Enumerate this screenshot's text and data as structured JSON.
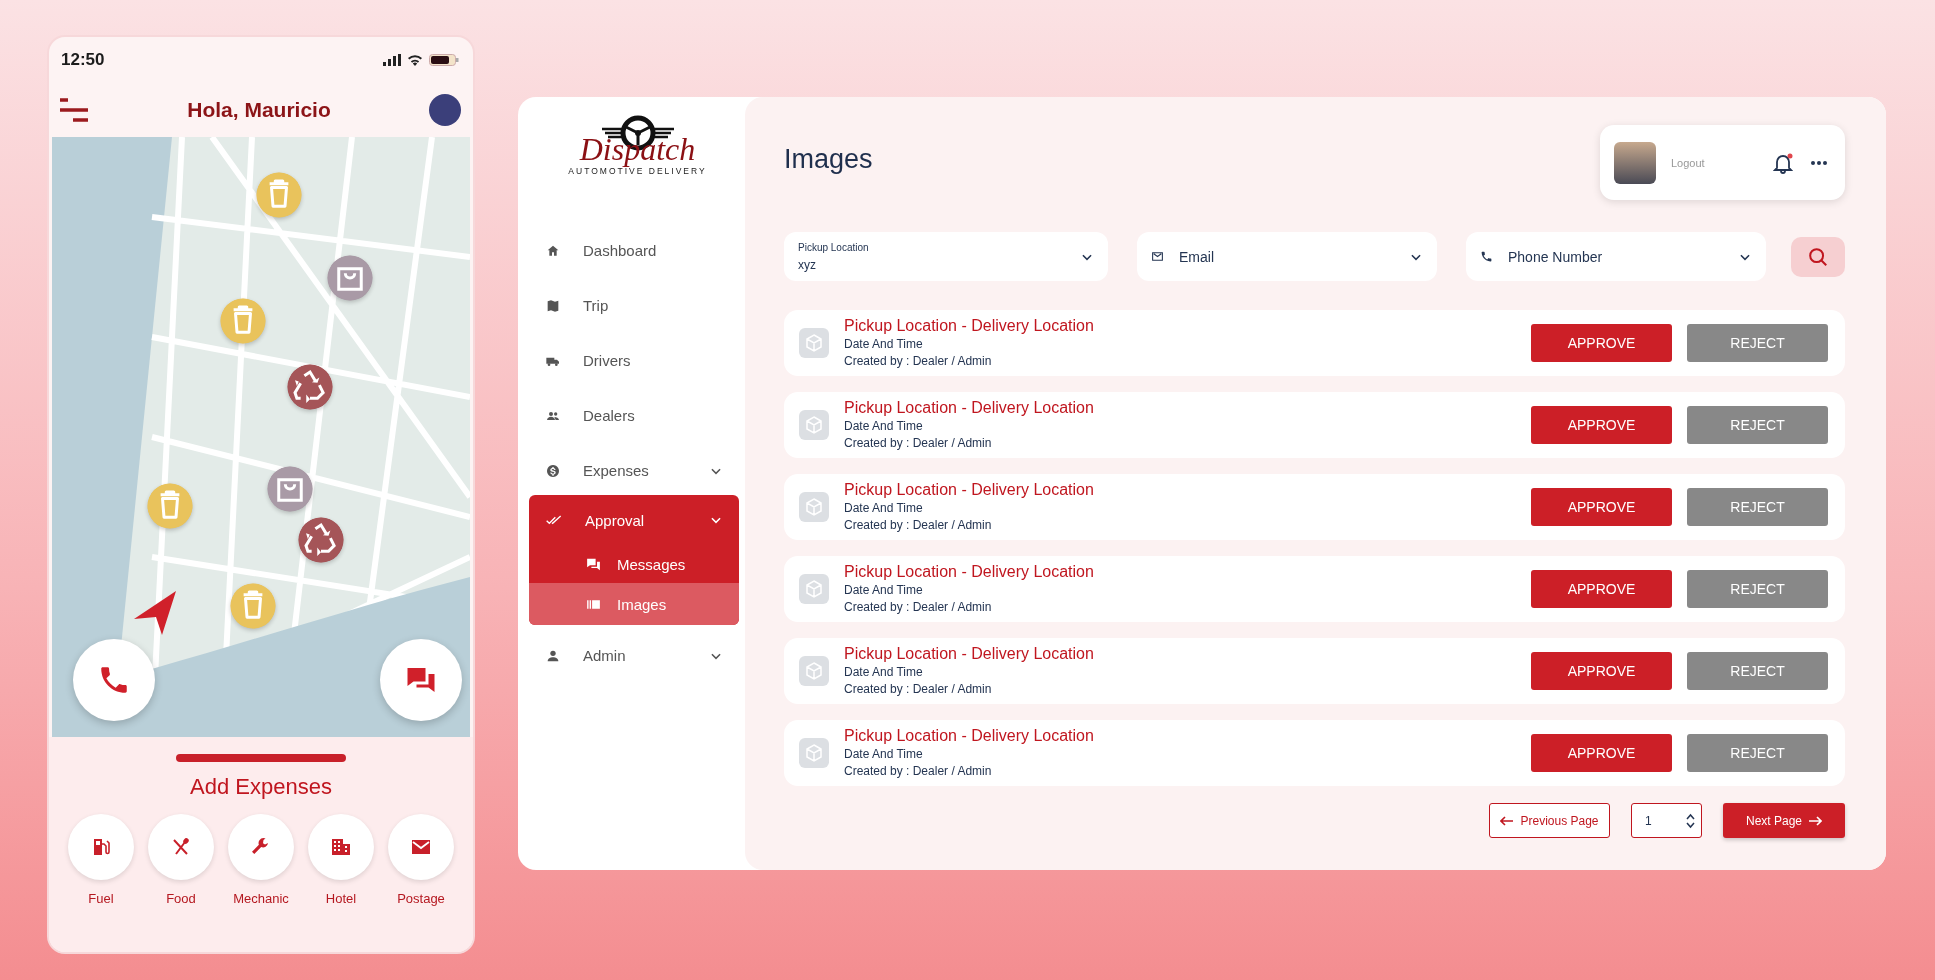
{
  "phone": {
    "time": "12:50",
    "greeting": "Hola, Mauricio",
    "map_pins": [
      {
        "kind": "trash",
        "color": "#e9c35c"
      },
      {
        "kind": "bag",
        "color": "#a99aa6"
      },
      {
        "kind": "trash",
        "color": "#e9c35c"
      },
      {
        "kind": "recycle",
        "color": "#a55558"
      },
      {
        "kind": "bag",
        "color": "#a99aa6"
      },
      {
        "kind": "trash",
        "color": "#e9c35c"
      },
      {
        "kind": "recycle",
        "color": "#a55558"
      },
      {
        "kind": "trash",
        "color": "#e9c35c"
      }
    ],
    "sheet_title": "Add Expenses",
    "expense_categories": [
      {
        "label": "Fuel",
        "kind": "fuel"
      },
      {
        "label": "Food",
        "kind": "food"
      },
      {
        "label": "Mechanic",
        "kind": "mechanic"
      },
      {
        "label": "Hotel",
        "kind": "hotel"
      },
      {
        "label": "Postage",
        "kind": "postage"
      }
    ]
  },
  "sidebar": {
    "logo": {
      "wordmark": "Dispatch",
      "tagline": "AUTOMOTIVE DELIVERY"
    },
    "items": [
      {
        "label": "Dashboard",
        "kind": "home",
        "expandable": false,
        "expanded": false,
        "selected": false
      },
      {
        "label": "Trip",
        "kind": "map",
        "expandable": false,
        "expanded": false,
        "selected": false
      },
      {
        "label": "Drivers",
        "kind": "truck",
        "expandable": false,
        "expanded": false,
        "selected": false
      },
      {
        "label": "Dealers",
        "kind": "people",
        "expandable": false,
        "expanded": false,
        "selected": false
      },
      {
        "label": "Expenses",
        "kind": "dollar",
        "expandable": true,
        "expanded": false,
        "selected": false
      },
      {
        "label": "Approval",
        "kind": "check",
        "expandable": true,
        "expanded": true,
        "selected": true,
        "children": [
          {
            "label": "Messages",
            "kind": "chat",
            "selected": false
          },
          {
            "label": "Images",
            "kind": "images",
            "selected": true
          }
        ]
      },
      {
        "label": "Admin",
        "kind": "person",
        "expandable": true,
        "expanded": false,
        "selected": false
      }
    ]
  },
  "main": {
    "title": "Images",
    "user_menu": {
      "label": "Logout",
      "notification": true
    },
    "filters": [
      {
        "kind": "labeled",
        "label": "Pickup Location",
        "value": "xyz"
      },
      {
        "kind": "mail",
        "placeholder": "Email"
      },
      {
        "kind": "phone",
        "placeholder": "Phone Number"
      }
    ],
    "rows": [
      {
        "title": "Pickup Location - Delivery Location",
        "subtitle": "Date And Time",
        "created_by": "Created by : Dealer / Admin",
        "approve": "APPROVE",
        "reject": "REJECT"
      },
      {
        "title": "Pickup Location - Delivery Location",
        "subtitle": "Date And Time",
        "created_by": "Created by : Dealer / Admin",
        "approve": "APPROVE",
        "reject": "REJECT"
      },
      {
        "title": "Pickup Location - Delivery Location",
        "subtitle": "Date And Time",
        "created_by": "Created by : Dealer / Admin",
        "approve": "APPROVE",
        "reject": "REJECT"
      },
      {
        "title": "Pickup Location - Delivery Location",
        "subtitle": "Date And Time",
        "created_by": "Created by : Dealer / Admin",
        "approve": "APPROVE",
        "reject": "REJECT"
      },
      {
        "title": "Pickup Location - Delivery Location",
        "subtitle": "Date And Time",
        "created_by": "Created by : Dealer / Admin",
        "approve": "APPROVE",
        "reject": "REJECT"
      },
      {
        "title": "Pickup Location - Delivery Location",
        "subtitle": "Date And Time",
        "created_by": "Created by : Dealer / Admin",
        "approve": "APPROVE",
        "reject": "REJECT"
      }
    ],
    "pagination": {
      "previous": "Previous Page",
      "page": "1",
      "next": "Next Page"
    }
  }
}
